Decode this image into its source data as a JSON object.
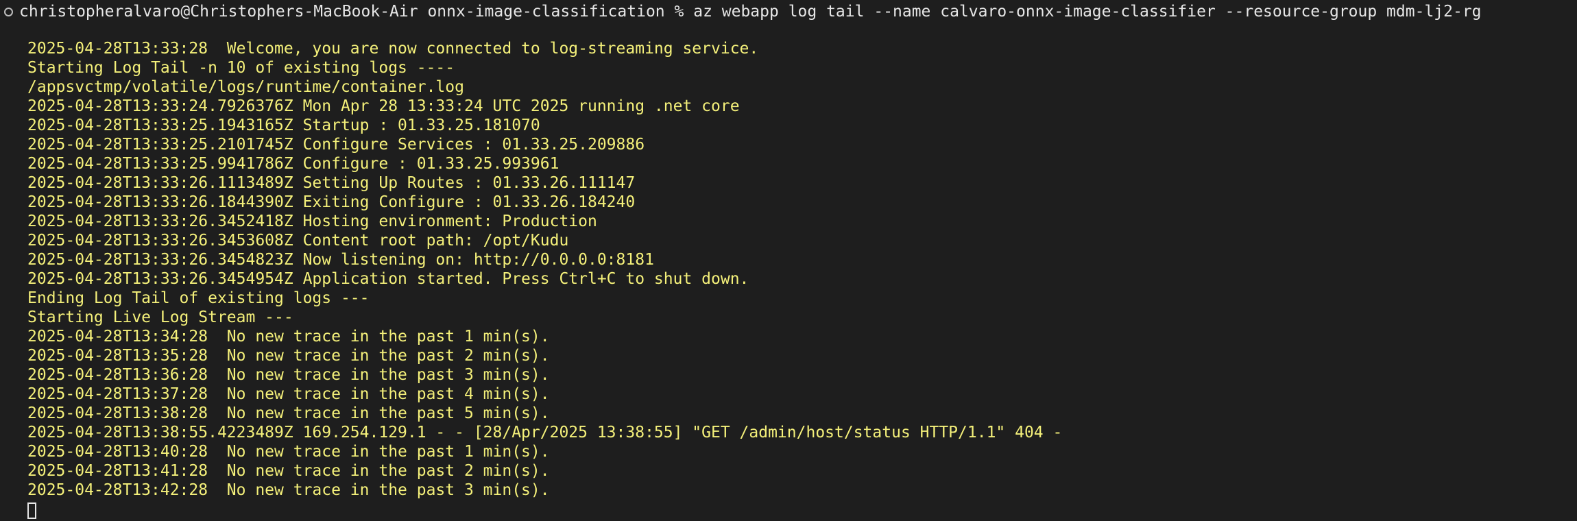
{
  "prompt": {
    "host": "christopheralvaro@Christophers-MacBook-Air",
    "cwd": "onnx-image-classification",
    "symbol": "%",
    "command": "az webapp log tail --name calvaro-onnx-image-classifier --resource-group mdm-lj2-rg"
  },
  "colors": {
    "background": "#1e1e1e",
    "prompt_text": "#e6e6e6",
    "log_text": "#f4f07a"
  },
  "log_lines": [
    "2025-04-28T13:33:28  Welcome, you are now connected to log-streaming service.",
    "Starting Log Tail -n 10 of existing logs ----",
    "/appsvctmp/volatile/logs/runtime/container.log",
    "2025-04-28T13:33:24.7926376Z Mon Apr 28 13:33:24 UTC 2025 running .net core",
    "2025-04-28T13:33:25.1943165Z Startup : 01.33.25.181070",
    "2025-04-28T13:33:25.2101745Z Configure Services : 01.33.25.209886",
    "2025-04-28T13:33:25.9941786Z Configure : 01.33.25.993961",
    "2025-04-28T13:33:26.1113489Z Setting Up Routes : 01.33.26.111147",
    "2025-04-28T13:33:26.1844390Z Exiting Configure : 01.33.26.184240",
    "2025-04-28T13:33:26.3452418Z Hosting environment: Production",
    "2025-04-28T13:33:26.3453608Z Content root path: /opt/Kudu",
    "2025-04-28T13:33:26.3454823Z Now listening on: http://0.0.0.0:8181",
    "2025-04-28T13:33:26.3454954Z Application started. Press Ctrl+C to shut down.",
    "Ending Log Tail of existing logs ---",
    "Starting Live Log Stream ---",
    "2025-04-28T13:34:28  No new trace in the past 1 min(s).",
    "2025-04-28T13:35:28  No new trace in the past 2 min(s).",
    "2025-04-28T13:36:28  No new trace in the past 3 min(s).",
    "2025-04-28T13:37:28  No new trace in the past 4 min(s).",
    "2025-04-28T13:38:28  No new trace in the past 5 min(s).",
    "2025-04-28T13:38:55.4223489Z 169.254.129.1 - - [28/Apr/2025 13:38:55] \"GET /admin/host/status HTTP/1.1\" 404 -",
    "2025-04-28T13:40:28  No new trace in the past 1 min(s).",
    "2025-04-28T13:41:28  No new trace in the past 2 min(s).",
    "2025-04-28T13:42:28  No new trace in the past 3 min(s)."
  ]
}
